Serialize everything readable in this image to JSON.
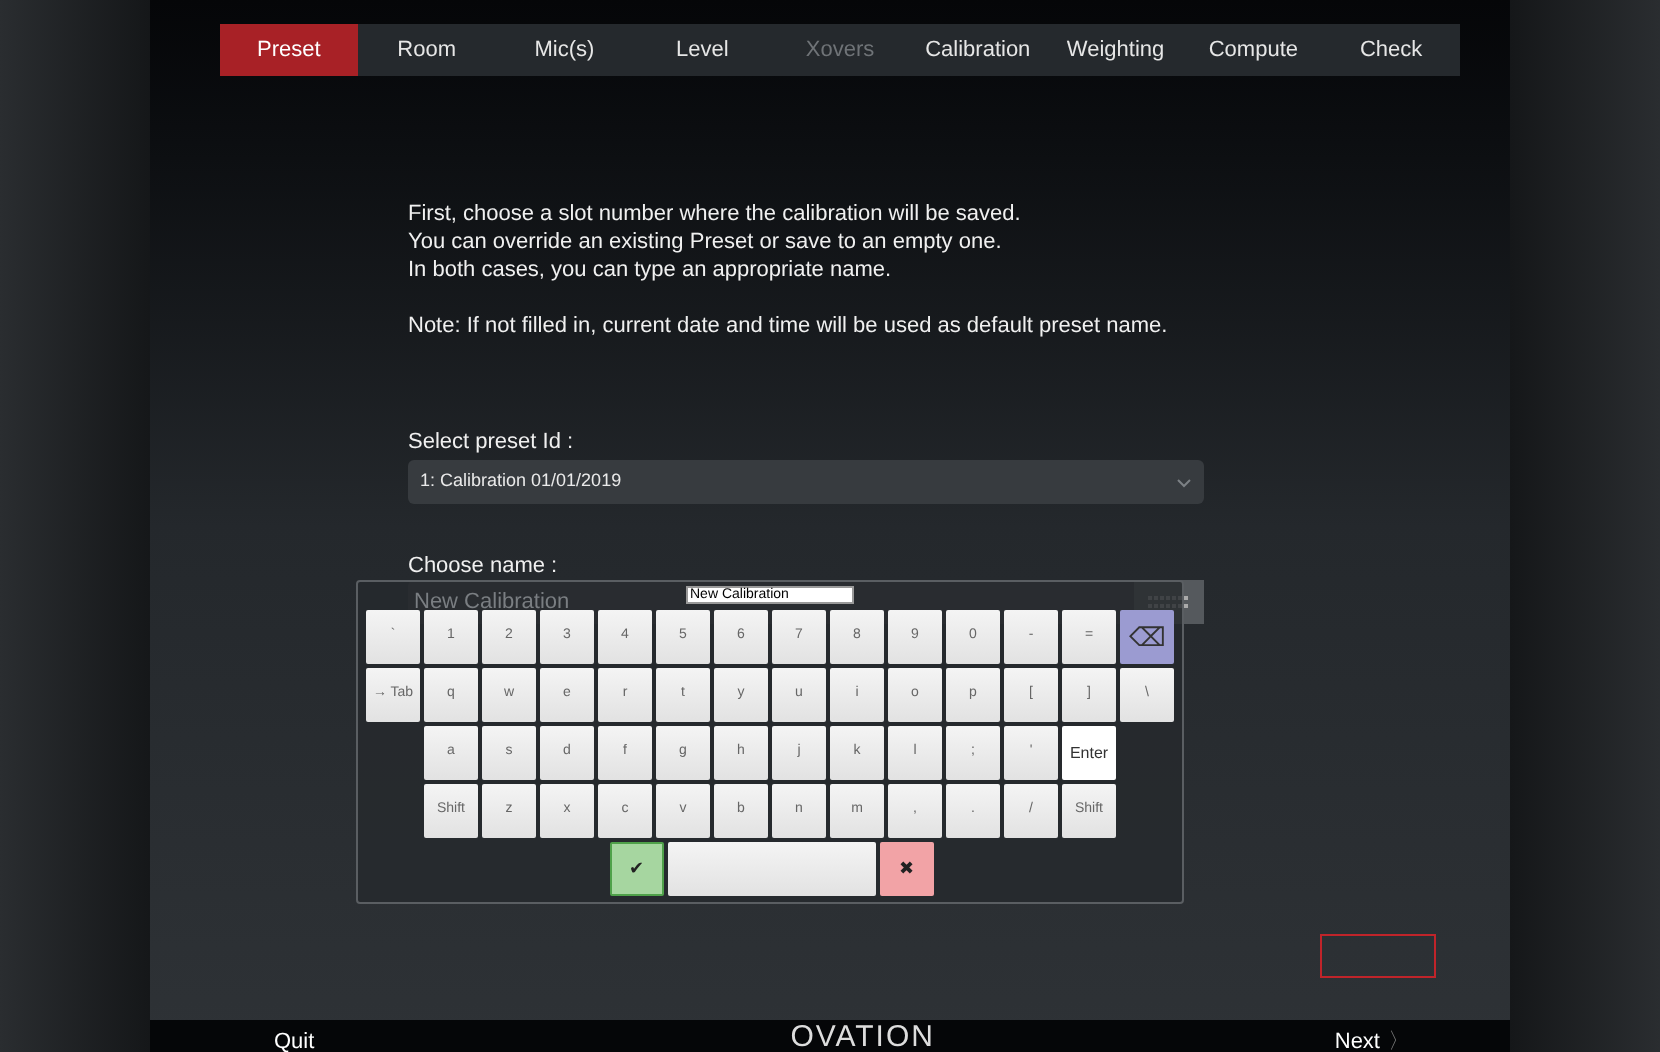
{
  "tabs": [
    {
      "label": "Preset",
      "selected": true,
      "disabled": false
    },
    {
      "label": "Room",
      "selected": false,
      "disabled": false
    },
    {
      "label": "Mic(s)",
      "selected": false,
      "disabled": false
    },
    {
      "label": "Level",
      "selected": false,
      "disabled": false
    },
    {
      "label": "Xovers",
      "selected": false,
      "disabled": true
    },
    {
      "label": "Calibration",
      "selected": false,
      "disabled": false
    },
    {
      "label": "Weighting",
      "selected": false,
      "disabled": false
    },
    {
      "label": "Compute",
      "selected": false,
      "disabled": false
    },
    {
      "label": "Check",
      "selected": false,
      "disabled": false
    }
  ],
  "intro": [
    "First, choose a slot number where the calibration will be saved.",
    "You can override an existing Preset or save to an empty one.",
    "In both cases, you can type an appropriate name."
  ],
  "note": "Note: If not filled in, current date and time will be used as default preset name.",
  "preset_select": {
    "label": "Select preset Id :",
    "value": "1: Calibration 01/01/2019"
  },
  "name_field": {
    "label": "Choose name :",
    "placeholder": "New Calibration"
  },
  "keyboard": {
    "input_value": "New Calibration",
    "rows": [
      {
        "keys": [
          {
            "label": "`",
            "kind": "key"
          },
          {
            "label": "1",
            "kind": "key"
          },
          {
            "label": "2",
            "kind": "key"
          },
          {
            "label": "3",
            "kind": "key"
          },
          {
            "label": "4",
            "kind": "key"
          },
          {
            "label": "5",
            "kind": "key"
          },
          {
            "label": "6",
            "kind": "key"
          },
          {
            "label": "7",
            "kind": "key"
          },
          {
            "label": "8",
            "kind": "key"
          },
          {
            "label": "9",
            "kind": "key"
          },
          {
            "label": "0",
            "kind": "key"
          },
          {
            "label": "-",
            "kind": "key"
          },
          {
            "label": "=",
            "kind": "key"
          },
          {
            "label": "⌫",
            "kind": "backspace"
          }
        ]
      },
      {
        "keys": [
          {
            "label": "→ Tab",
            "kind": "key"
          },
          {
            "label": "q",
            "kind": "key"
          },
          {
            "label": "w",
            "kind": "key"
          },
          {
            "label": "e",
            "kind": "key"
          },
          {
            "label": "r",
            "kind": "key"
          },
          {
            "label": "t",
            "kind": "key"
          },
          {
            "label": "y",
            "kind": "key"
          },
          {
            "label": "u",
            "kind": "key"
          },
          {
            "label": "i",
            "kind": "key"
          },
          {
            "label": "o",
            "kind": "key"
          },
          {
            "label": "p",
            "kind": "key"
          },
          {
            "label": "[",
            "kind": "key"
          },
          {
            "label": "]",
            "kind": "key"
          },
          {
            "label": "\\",
            "kind": "key"
          }
        ]
      },
      {
        "keys": [
          {
            "label": "a",
            "kind": "key"
          },
          {
            "label": "s",
            "kind": "key"
          },
          {
            "label": "d",
            "kind": "key"
          },
          {
            "label": "f",
            "kind": "key"
          },
          {
            "label": "g",
            "kind": "key"
          },
          {
            "label": "h",
            "kind": "key"
          },
          {
            "label": "j",
            "kind": "key"
          },
          {
            "label": "k",
            "kind": "key"
          },
          {
            "label": "l",
            "kind": "key"
          },
          {
            "label": ";",
            "kind": "key"
          },
          {
            "label": "'",
            "kind": "key"
          },
          {
            "label": "Enter",
            "kind": "enter"
          }
        ]
      },
      {
        "keys": [
          {
            "label": "Shift",
            "kind": "key"
          },
          {
            "label": "z",
            "kind": "key"
          },
          {
            "label": "x",
            "kind": "key"
          },
          {
            "label": "c",
            "kind": "key"
          },
          {
            "label": "v",
            "kind": "key"
          },
          {
            "label": "b",
            "kind": "key"
          },
          {
            "label": "n",
            "kind": "key"
          },
          {
            "label": "m",
            "kind": "key"
          },
          {
            "label": ",",
            "kind": "key"
          },
          {
            "label": ".",
            "kind": "key"
          },
          {
            "label": "/",
            "kind": "key"
          },
          {
            "label": "Shift",
            "kind": "key"
          }
        ]
      }
    ],
    "bottom_keys": [
      {
        "label": "✔",
        "kind": "accept"
      },
      {
        "kind": "space"
      },
      {
        "label": "✖",
        "kind": "cancel"
      }
    ]
  },
  "footer": {
    "quit": "Quit",
    "logo": "OVATION",
    "next": "Next",
    "next_arrow": "〉"
  }
}
